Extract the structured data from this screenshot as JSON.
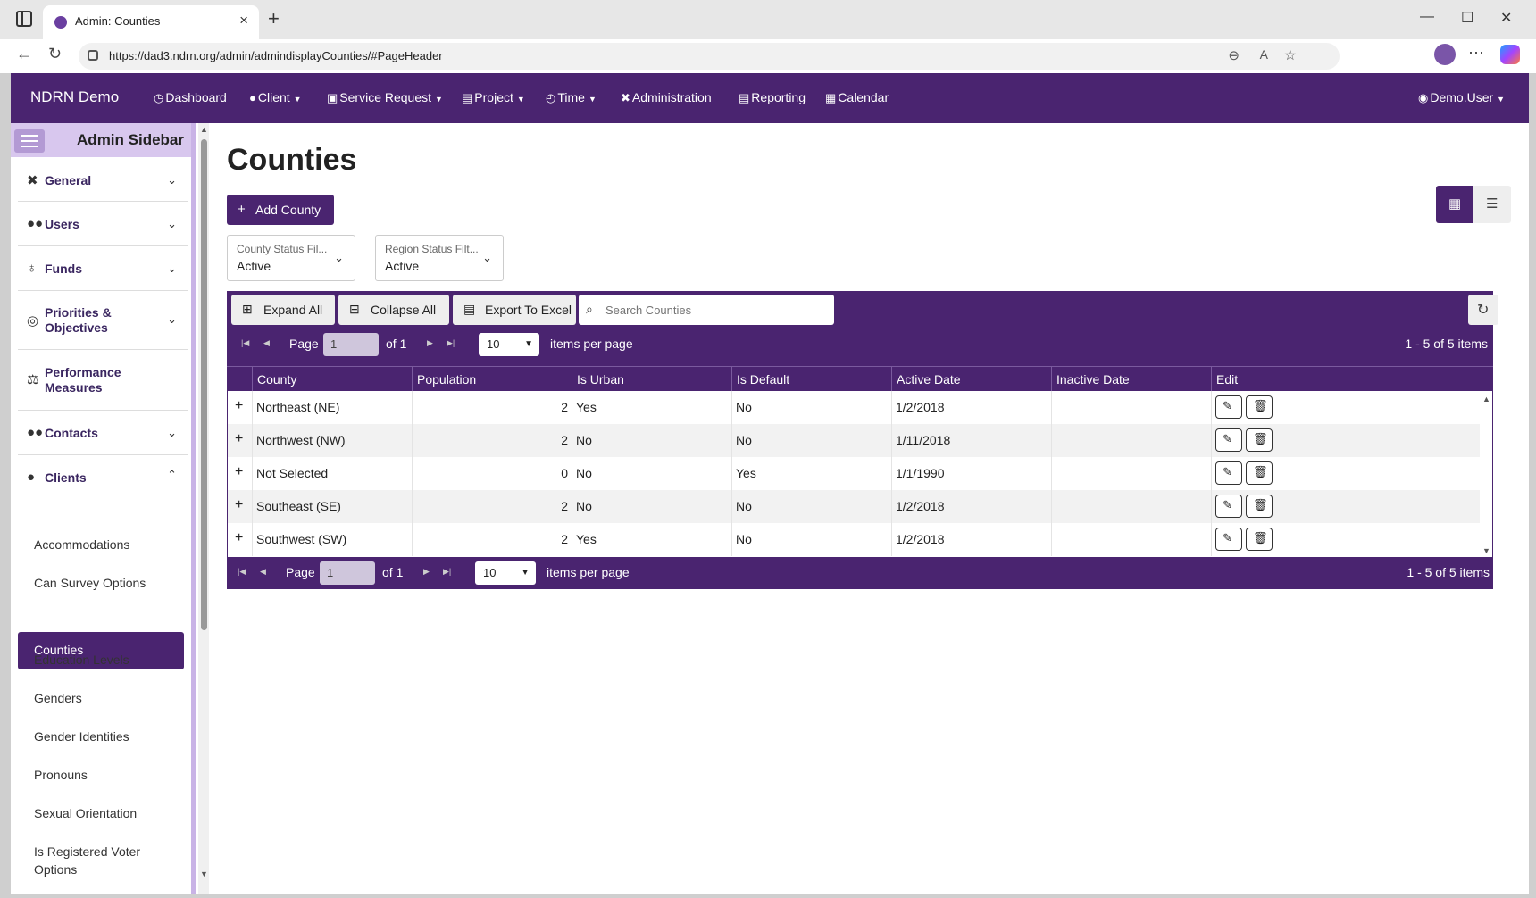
{
  "browser": {
    "tab_title": "Admin: Counties",
    "url": "https://dad3.ndrn.org/admin/admindisplayCounties/#PageHeader"
  },
  "nav": {
    "brand": "NDRN Demo",
    "items": [
      {
        "label": "Dashboard",
        "icon": "dashboard-icon"
      },
      {
        "label": "Client",
        "icon": "user-icon"
      },
      {
        "label": "Service Request",
        "icon": "briefcase-icon"
      },
      {
        "label": "Project",
        "icon": "clipboard-icon"
      },
      {
        "label": "Time",
        "icon": "clock-icon"
      },
      {
        "label": "Administration",
        "icon": "tools-icon"
      },
      {
        "label": "Reporting",
        "icon": "report-icon"
      },
      {
        "label": "Calendar",
        "icon": "calendar-icon"
      }
    ],
    "user": "Demo.User"
  },
  "sidebar": {
    "title": "Admin Sidebar",
    "sections": [
      {
        "label": "General"
      },
      {
        "label": "Users"
      },
      {
        "label": "Funds"
      },
      {
        "label": "Priorities & Objectives"
      },
      {
        "label": "Performance Measures"
      },
      {
        "label": "Contacts"
      },
      {
        "label": "Clients"
      }
    ],
    "client_items": [
      "Accommodations",
      "Can Survey Options",
      "Counties",
      "Education Levels",
      "Genders",
      "Gender Identities",
      "Pronouns",
      "Sexual Orientation",
      "Is Registered Voter Options"
    ],
    "active_item": "Counties"
  },
  "main": {
    "title": "Counties",
    "add_button": "Add County",
    "filters": [
      {
        "label": "County Status Fil...",
        "value": "Active"
      },
      {
        "label": "Region Status Filt...",
        "value": "Active"
      }
    ]
  },
  "grid": {
    "toolbar": {
      "expand_all": "Expand All",
      "collapse_all": "Collapse All",
      "export": "Export To Excel",
      "search_placeholder": "Search Counties"
    },
    "pager": {
      "page_label": "Page",
      "page": "1",
      "of": "of 1",
      "page_size": "10",
      "items_per_page": "items per page",
      "info": "1 - 5 of 5 items"
    },
    "columns": [
      "County",
      "Population",
      "Is Urban",
      "Is Default",
      "Active Date",
      "Inactive Date",
      "Edit"
    ],
    "rows": [
      {
        "county": "Northeast (NE)",
        "population": "2",
        "is_urban": "Yes",
        "is_default": "No",
        "active_date": "1/2/2018",
        "inactive_date": ""
      },
      {
        "county": "Northwest (NW)",
        "population": "2",
        "is_urban": "No",
        "is_default": "No",
        "active_date": "1/11/2018",
        "inactive_date": ""
      },
      {
        "county": "Not Selected",
        "population": "0",
        "is_urban": "No",
        "is_default": "Yes",
        "active_date": "1/1/1990",
        "inactive_date": ""
      },
      {
        "county": "Southeast (SE)",
        "population": "2",
        "is_urban": "No",
        "is_default": "No",
        "active_date": "1/2/2018",
        "inactive_date": ""
      },
      {
        "county": "Southwest (SW)",
        "population": "2",
        "is_urban": "Yes",
        "is_default": "No",
        "active_date": "1/2/2018",
        "inactive_date": ""
      }
    ]
  },
  "colors": {
    "primary": "#4a2470",
    "sidebar_accent": "#d8c7ee"
  }
}
